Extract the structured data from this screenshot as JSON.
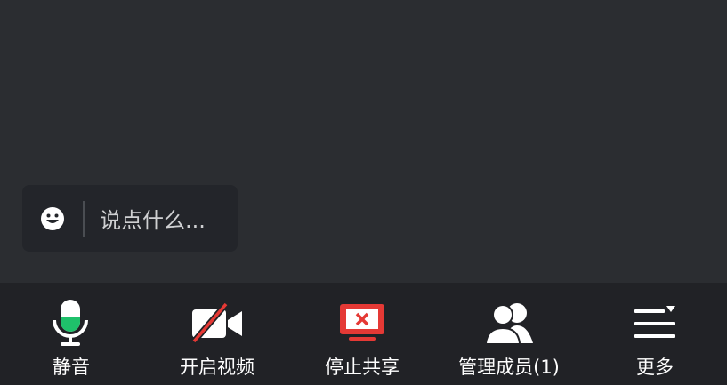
{
  "chat": {
    "placeholder": "说点什么...",
    "emoji_icon": "smiley-face-icon"
  },
  "toolbar": {
    "items": [
      {
        "label": "静音",
        "icon": "microphone-icon"
      },
      {
        "label": "开启视频",
        "icon": "video-off-icon"
      },
      {
        "label": "停止共享",
        "icon": "stop-screen-share-icon"
      },
      {
        "label": "管理成员(1)",
        "icon": "members-icon"
      },
      {
        "label": "更多",
        "icon": "more-menu-icon"
      }
    ]
  },
  "colors": {
    "background": "#2b2d31",
    "toolbar": "#212226",
    "mic_active": "#1fc16b",
    "stop_share": "#e53935",
    "video_off_slash": "#e53935"
  }
}
